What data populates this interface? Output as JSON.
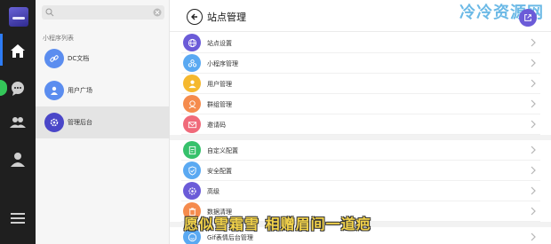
{
  "rail": {
    "items": [
      "home-icon",
      "chat-icon",
      "contacts-icon",
      "user-icon",
      "menu-icon"
    ]
  },
  "list": {
    "search_placeholder": "",
    "section_title": "小程序列表",
    "items": [
      {
        "label": "DC文档",
        "color": "#5b8def"
      },
      {
        "label": "用户广场",
        "color": "#5b8def"
      },
      {
        "label": "管理后台",
        "color": "#4a46c8"
      }
    ]
  },
  "header": {
    "title": "站点管理",
    "watermark": "冷冷资源网"
  },
  "settings": {
    "group1": [
      {
        "label": "站点设置",
        "icon": "globe-icon",
        "color": "#6b5bd8"
      },
      {
        "label": "小程序管理",
        "icon": "apps-icon",
        "color": "#5aa9f2"
      },
      {
        "label": "用户管理",
        "icon": "user-icon",
        "color": "#f5b82e"
      },
      {
        "label": "群组管理",
        "icon": "group-icon",
        "color": "#f58b4d"
      },
      {
        "label": "邀请码",
        "icon": "mail-icon",
        "color": "#f06a7a"
      }
    ],
    "group2": [
      {
        "label": "自定义配置",
        "icon": "doc-icon",
        "color": "#36c16b"
      },
      {
        "label": "安全配置",
        "icon": "shield-icon",
        "color": "#5aa9f2"
      },
      {
        "label": "高级",
        "icon": "gear-icon",
        "color": "#6b5bd8"
      },
      {
        "label": "数据清理",
        "icon": "trash-icon",
        "color": "#f58b4d"
      }
    ],
    "group3": [
      {
        "label": "Gif表情后台管理",
        "icon": "smile-icon",
        "color": "#5aa9f2"
      }
    ]
  },
  "overlay": {
    "subtitle": "愿似雪霜雪 相赠眉间一道疤"
  },
  "colors": {
    "accent": "#6b5bd8",
    "rail_bg": "#1f1f1f",
    "active_indicator": "#2d7cf6"
  }
}
